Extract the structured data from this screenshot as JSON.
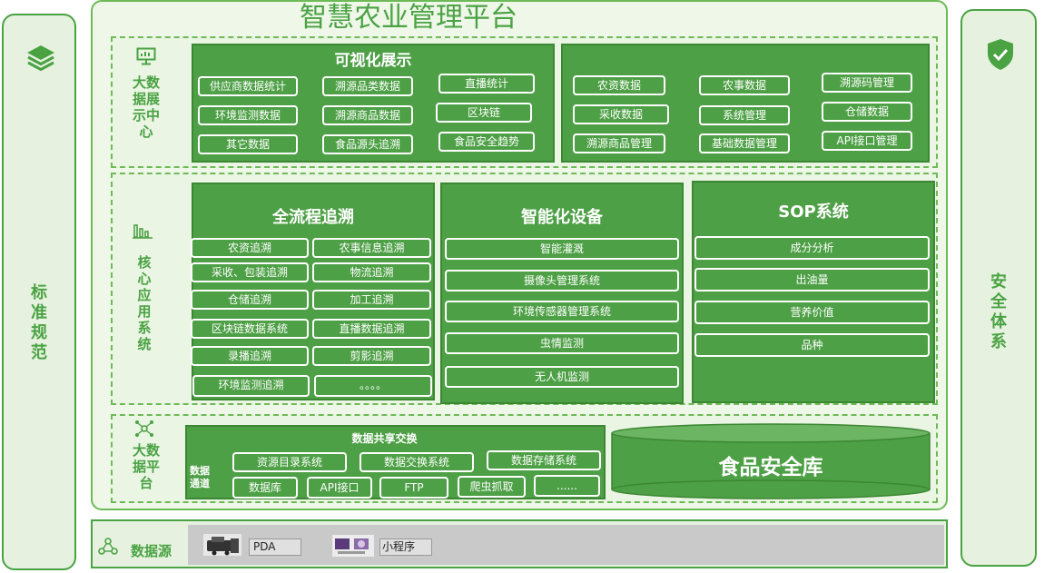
{
  "title": "智慧农业管理平台",
  "left_side": {
    "label": [
      "标",
      "准",
      "规",
      "范"
    ],
    "icon": "layers-icon"
  },
  "right_side": {
    "label": [
      "安",
      "全",
      "体",
      "系"
    ],
    "icon": "shield-check-icon"
  },
  "display_center": {
    "label": [
      "大数",
      "据展",
      "示中",
      "心"
    ],
    "icon": "monitor-icon",
    "panel_title": "可视化展示",
    "left_items": [
      "供应商数据统计",
      "溯源品类数据",
      "直播统计",
      "环境监测数据",
      "溯源商品数据",
      "区块链",
      "其它数据",
      "食品源头追溯",
      "食品安全趋势"
    ],
    "right_items": [
      "农资数据",
      "农事数据",
      "溯源码管理",
      "采收数据",
      "系统管理",
      "仓储数据",
      "溯源商品管理",
      "基础数据管理",
      "API接口管理"
    ]
  },
  "core": {
    "label": [
      "核",
      "心",
      "应",
      "用",
      "系",
      "统"
    ],
    "icon": "bar-chart-icon",
    "trace": {
      "title": "全流程追溯",
      "items": [
        "农资追溯",
        "农事信息追溯",
        "采收、包装追溯",
        "物流追溯",
        "仓储追溯",
        "加工追溯",
        "区块链数据系统",
        "直播数据追溯",
        "录播追溯",
        "剪影追溯",
        "环境监测追溯",
        "。。。。"
      ]
    },
    "devices": {
      "title": "智能化设备",
      "items": [
        "智能灌溉",
        "摄像头管理系统",
        "环境传感器管理系统",
        "虫情监测",
        "无人机监测"
      ]
    },
    "sop": {
      "title": "SOP系统",
      "items": [
        "成分分析",
        "出油量",
        "营养价值",
        "品种"
      ]
    }
  },
  "platform": {
    "label": [
      "大数",
      "据平",
      "台"
    ],
    "icon": "network-icon",
    "exchange_title": "数据共享交换",
    "channel_label": [
      "数据",
      "通道"
    ],
    "row1": [
      "资源目录系统",
      "数据交换系统",
      "数据存储系统"
    ],
    "row2": [
      "数据库",
      "API接口",
      "FTP",
      "爬虫抓取",
      "......"
    ],
    "food_db": "食品安全库"
  },
  "datasource": {
    "label": "数据源",
    "icon": "cloud-nodes-icon",
    "items": [
      {
        "label": "PDA",
        "icon": "pda-device-icon"
      },
      {
        "label": "小程序",
        "icon": "mini-program-icon"
      }
    ]
  }
}
